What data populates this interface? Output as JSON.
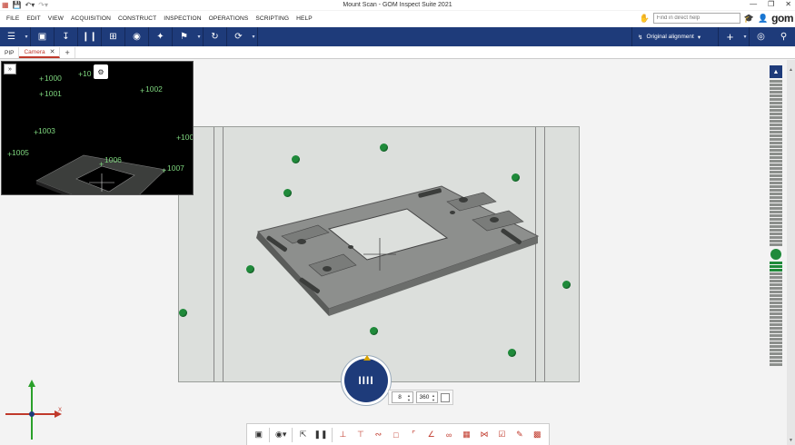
{
  "window": {
    "title": "Mount Scan - GOM Inspect Suite 2021"
  },
  "menu": {
    "items": [
      "FILE",
      "EDIT",
      "VIEW",
      "ACQUISITION",
      "CONSTRUCT",
      "INSPECTION",
      "OPERATIONS",
      "SCRIPTING",
      "HELP"
    ],
    "help_placeholder": "Find in direct help",
    "logo": "gom"
  },
  "toolbar": {
    "alignment_label": "Original alignment",
    "accent": "#1e3b7a"
  },
  "tabs": {
    "items": [
      {
        "label": "PIP",
        "active": false
      },
      {
        "label": "Camera",
        "active": true
      }
    ]
  },
  "pip": {
    "labels": [
      "1000",
      "1001",
      "10",
      "1002",
      "1003",
      "100",
      "1005",
      "1006",
      "1007"
    ]
  },
  "scan": {
    "label": "IIII",
    "value_a": "8",
    "value_b": "360"
  },
  "colors": {
    "marker": "#1f8a3a",
    "pip_label": "#7ed67e",
    "active_tab": "#c0392b",
    "panel": "#dcdfdc"
  },
  "icons": {
    "toolbar": [
      "hamburger-icon",
      "view-icon",
      "import-icon",
      "columns-icon",
      "crop-icon",
      "target-icon",
      "sparkle-icon",
      "flag-icon",
      "refresh-icon",
      "rotate-icon"
    ],
    "bottom": [
      "screenshot-icon",
      "scan-mode-icon",
      "select-icon",
      "pause-icon",
      "measure-icon",
      "height-icon",
      "profile-icon",
      "box-icon",
      "edge-icon",
      "angle-icon",
      "link-icon",
      "grid-icon",
      "cross-icon",
      "check-icon",
      "edit-icon",
      "settings-icon"
    ]
  }
}
